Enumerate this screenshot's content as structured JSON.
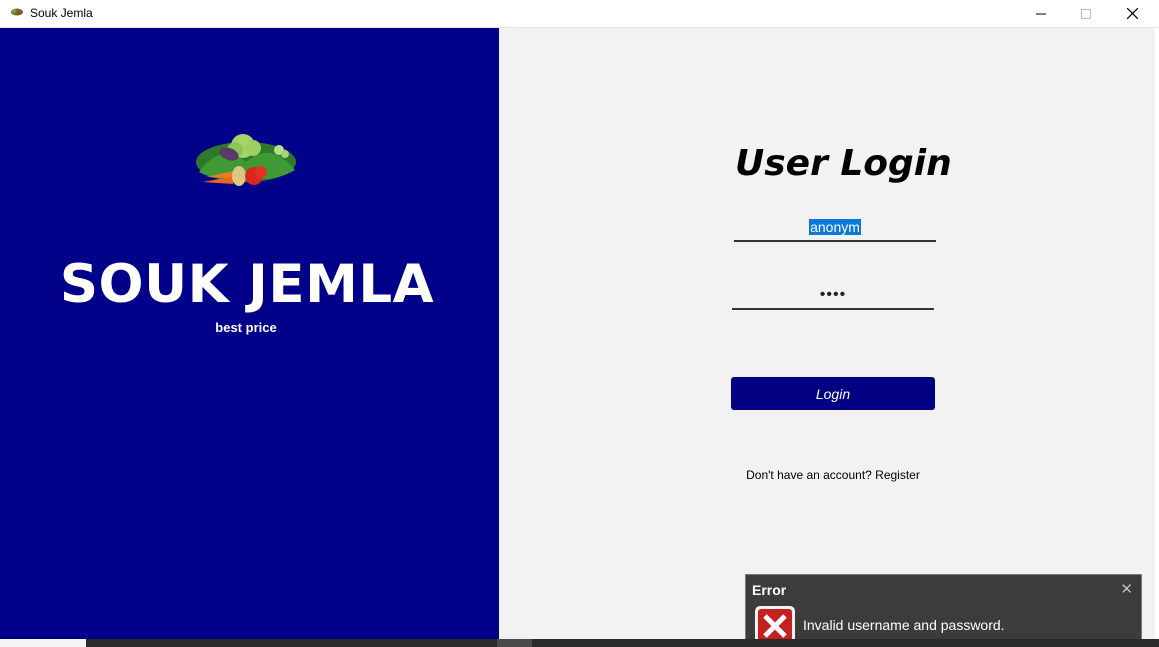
{
  "window": {
    "title": "Souk Jemla",
    "icons": {
      "app": "vegetables-icon",
      "minimize": "minimize-icon",
      "maximize": "maximize-icon",
      "close": "close-icon"
    }
  },
  "brand": {
    "logo_icon": "vegetables-logo-icon",
    "name": "SOUK JEMLA",
    "slogan": "best price",
    "panel_color": "#000088"
  },
  "login": {
    "title": "User Login",
    "username_value": "anonym",
    "password_mask": "••••",
    "button_label": "Login",
    "button_color": "#000080",
    "register_text": "Don't have an account? Register"
  },
  "toast": {
    "title": "Error",
    "message": "Invalid username and password.",
    "icon": "error-icon",
    "close_icon": "close-icon"
  }
}
